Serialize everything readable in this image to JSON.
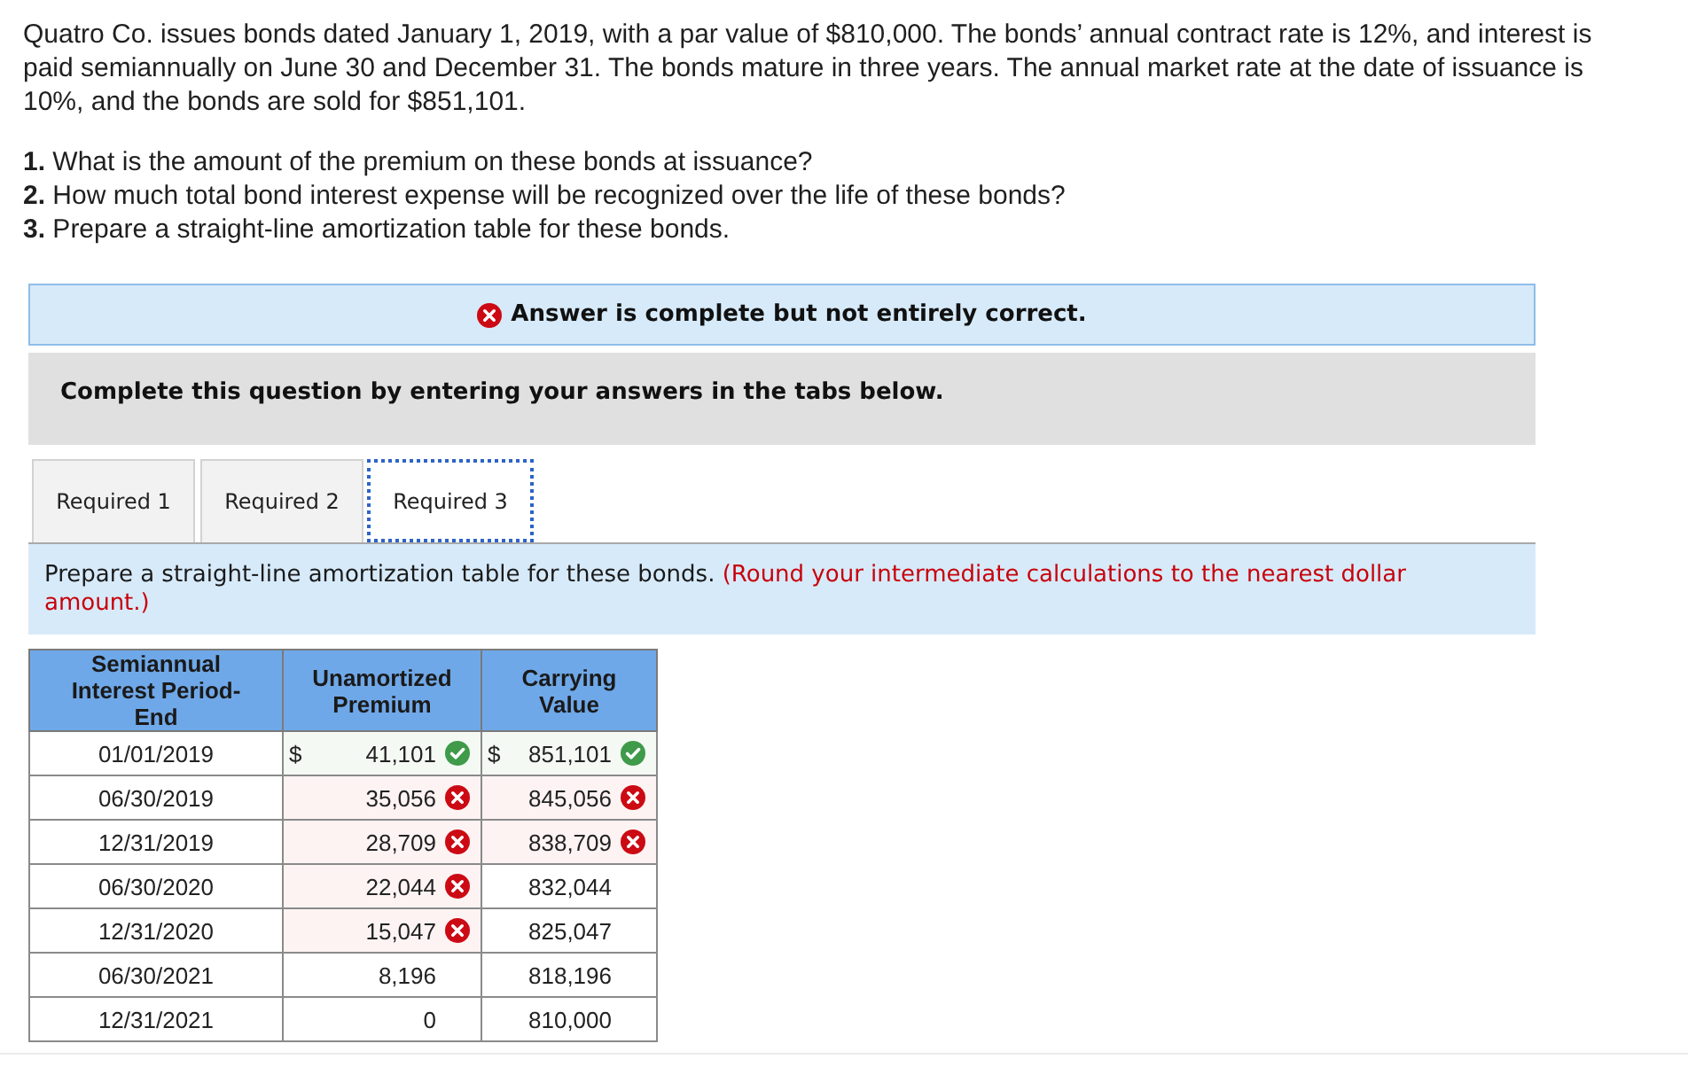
{
  "problem": {
    "paragraph": "Quatro Co. issues bonds dated January 1, 2019, with a par value of $810,000. The bonds’ annual contract rate is 12%, and interest is paid semiannually on June 30 and December 31. The bonds mature in three years. The annual market rate at the date of issuance is 10%, and the bonds are sold for $851,101.",
    "questions": [
      "**1.** What is the amount of the premium on these bonds at issuance?",
      "**2.** How much total bond interest expense will be recognized over the life of these bonds?",
      "**3.** Prepare a straight-line amortization table for these bonds."
    ]
  },
  "result_banner": {
    "kind": "incorrect",
    "text": "Answer is complete but not entirely correct."
  },
  "instructions": {
    "text": "Complete this question by entering your answers in the tabs below."
  },
  "tabs": [
    {
      "label": "Required 1",
      "selected": false
    },
    {
      "label": "Required 2",
      "selected": false
    },
    {
      "label": "Required 3",
      "selected": true
    }
  ],
  "tab_panel": {
    "prompt": "Prepare a straight-line amortization table for these bonds.",
    "note": "(Round your intermediate calculations to the nearest dollar amount.)"
  },
  "table": {
    "columns": [
      "Semiannual Interest Period-End",
      "Unamortized Premium",
      "Carrying Value"
    ],
    "rows": [
      {
        "period": "01/01/2019",
        "premium": {
          "currency": "$",
          "value": "41,101",
          "correct": true
        },
        "carrying_value": {
          "currency": "$",
          "value": "851,101",
          "correct": true
        }
      },
      {
        "period": "06/30/2019",
        "premium": {
          "value": "35,056",
          "correct": false
        },
        "carrying_value": {
          "value": "845,056",
          "correct": false
        }
      },
      {
        "period": "12/31/2019",
        "premium": {
          "value": "28,709",
          "correct": false
        },
        "carrying_value": {
          "value": "838,709",
          "correct": false
        }
      },
      {
        "period": "06/30/2020",
        "premium": {
          "value": "22,044",
          "correct": false
        },
        "carrying_value": {
          "value": "832,044"
        }
      },
      {
        "period": "12/31/2020",
        "premium": {
          "value": "15,047",
          "correct": false
        },
        "carrying_value": {
          "value": "825,047"
        }
      },
      {
        "period": "06/30/2021",
        "premium": {
          "value": "8,196"
        },
        "carrying_value": {
          "value": "818,196"
        }
      },
      {
        "period": "12/31/2021",
        "premium": {
          "value": "0"
        },
        "carrying_value": {
          "value": "810,000"
        }
      }
    ]
  }
}
